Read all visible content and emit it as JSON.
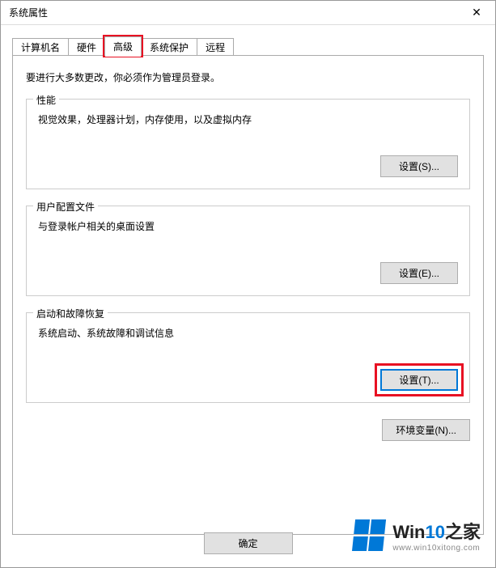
{
  "window": {
    "title": "系统属性",
    "close_glyph": "✕"
  },
  "tabs": {
    "computer_name": "计算机名",
    "hardware": "硬件",
    "advanced": "高级",
    "system_protection": "系统保护",
    "remote": "远程"
  },
  "panel": {
    "intro": "要进行大多数更改，你必须作为管理员登录。",
    "performance": {
      "title": "性能",
      "desc": "视觉效果，处理器计划，内存使用，以及虚拟内存",
      "button": "设置(S)..."
    },
    "user_profiles": {
      "title": "用户配置文件",
      "desc": "与登录帐户相关的桌面设置",
      "button": "设置(E)..."
    },
    "startup_recovery": {
      "title": "启动和故障恢复",
      "desc": "系统启动、系统故障和调试信息",
      "button": "设置(T)..."
    },
    "env_vars_button": "环境变量(N)..."
  },
  "bottom": {
    "ok": "确定"
  },
  "watermark": {
    "brand_prefix": "Win",
    "brand_accent": "10",
    "brand_suffix": "之家",
    "url": "www.win10xitong.com"
  }
}
